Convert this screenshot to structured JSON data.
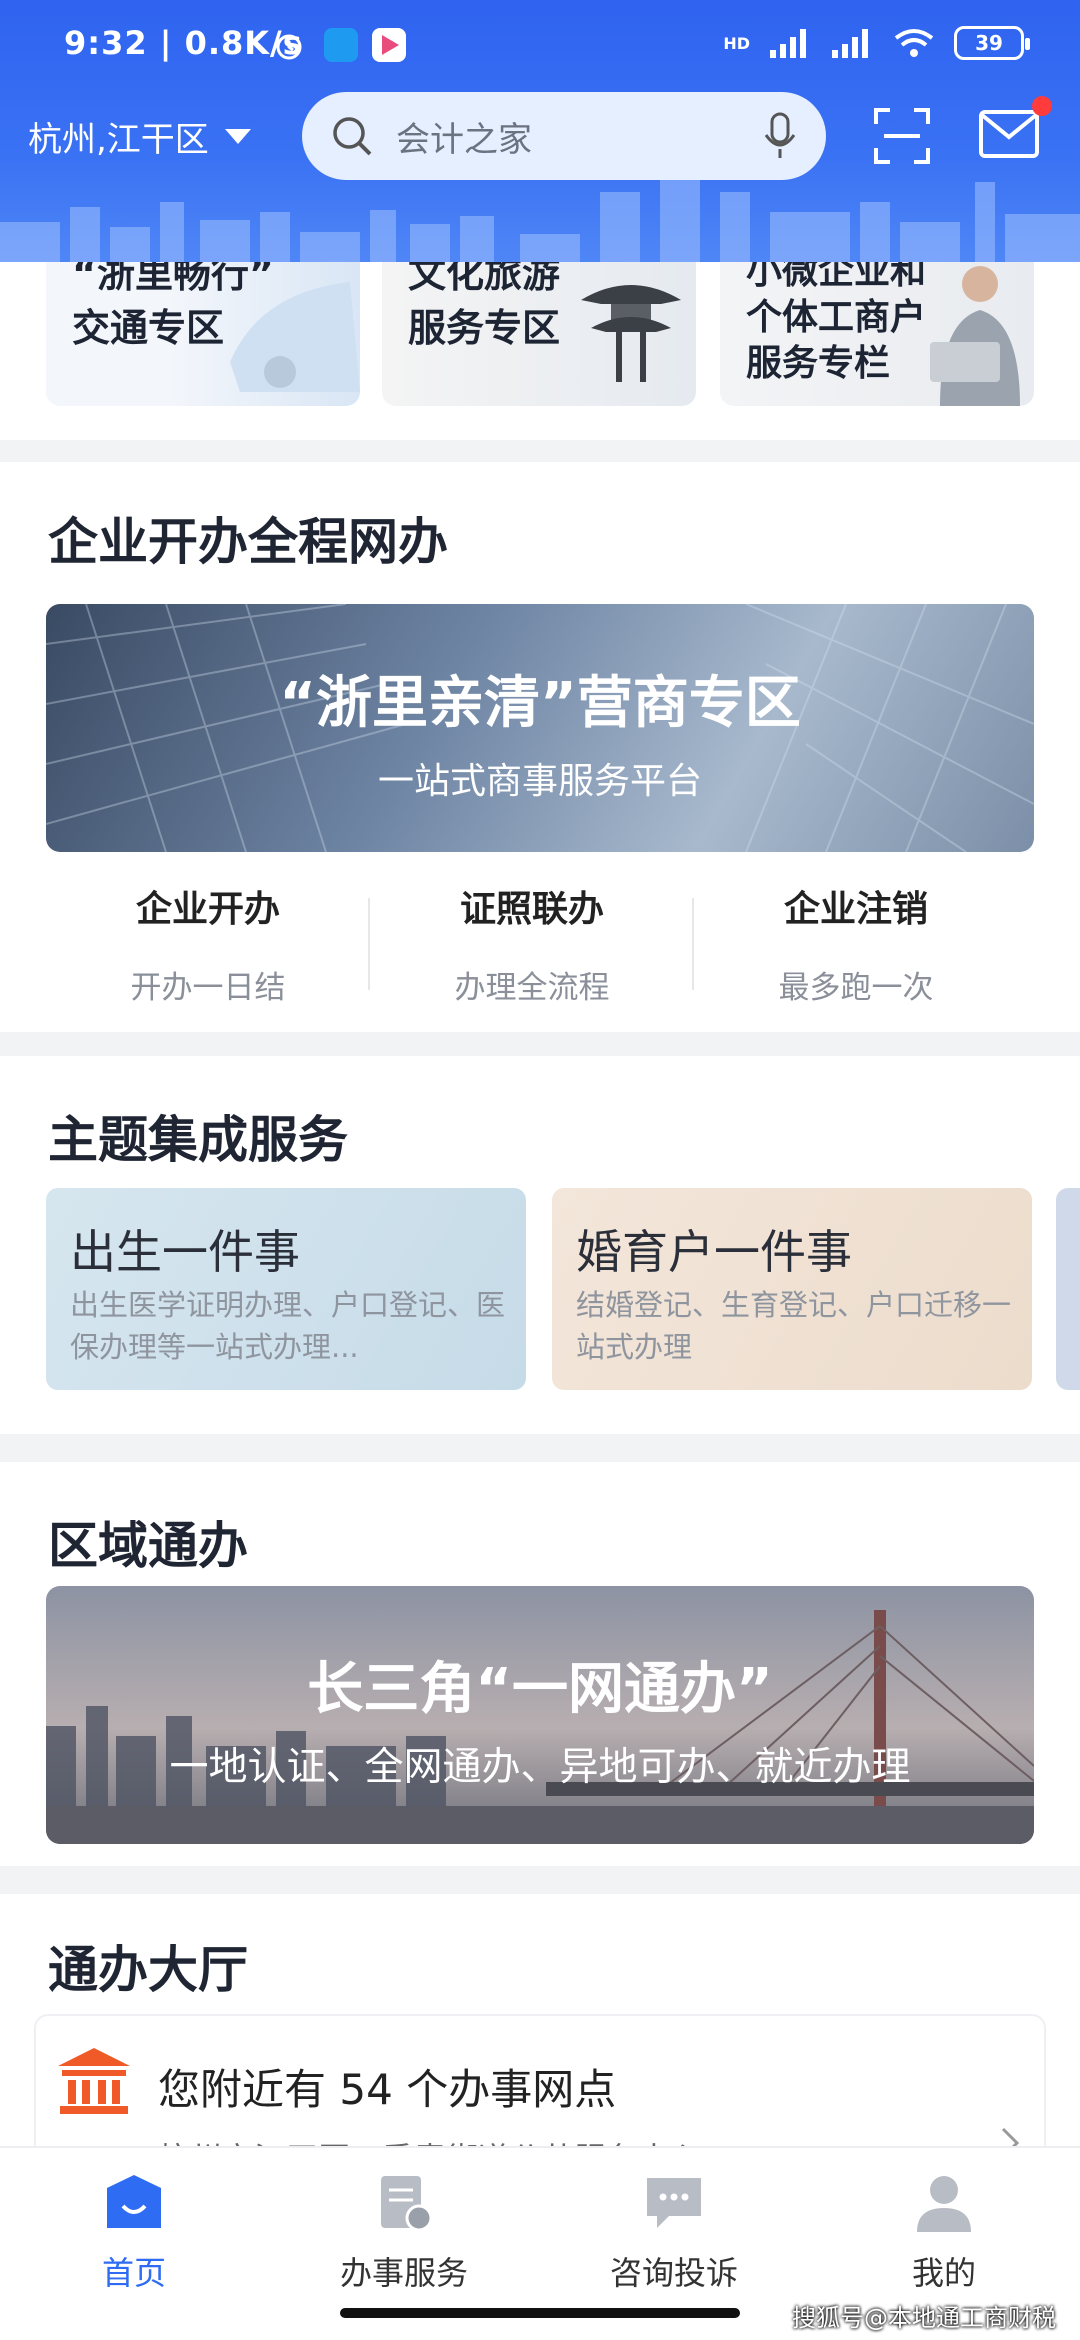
{
  "status_bar": {
    "time": "9:32",
    "net_speed": "0.8K/s",
    "signal_label": "HD",
    "battery": "39"
  },
  "header": {
    "location": "杭州,江干区",
    "search_placeholder": "会计之家",
    "colors": {
      "primary": "#2f63f0",
      "badge": "#ff3b3b"
    }
  },
  "top_cards": [
    {
      "label_line1": "“浙里畅行”",
      "label_line2": "交通专区"
    },
    {
      "label_line1": "文化旅游",
      "label_line2": "服务专区"
    },
    {
      "label_line1": "小微企业和",
      "label_line2": "个体工商户",
      "label_line3": "服务专栏"
    }
  ],
  "enterprise": {
    "title": "企业开办全程网办",
    "banner_title": "“浙里亲清”营商专区",
    "banner_sub": "一站式商事服务平台",
    "items": [
      {
        "title": "企业开办",
        "sub": "开办一日结"
      },
      {
        "title": "证照联办",
        "sub": "办理全流程"
      },
      {
        "title": "企业注销",
        "sub": "最多跑一次"
      }
    ]
  },
  "themes": {
    "title": "主题集成服务",
    "cards": [
      {
        "title": "出生一件事",
        "desc": "出生医学证明办理、户口登记、医保办理等一站式办理..."
      },
      {
        "title": "婚育户一件事",
        "desc": "结婚登记、生育登记、户口迁移一站式办理"
      }
    ]
  },
  "region": {
    "title": "区域通办",
    "banner_title": "长三角“一网通办”",
    "banner_sub": "一地认证、全网通办、异地可办、就近办理"
  },
  "hall": {
    "title": "通办大厅",
    "nearby_prefix": "您附近有",
    "nearby_count": "54",
    "nearby_suffix": "个办事网点",
    "sub": "杭州市江干区四季青街道公共服务中心"
  },
  "tabbar": [
    {
      "label": "首页",
      "active": true
    },
    {
      "label": "办事服务"
    },
    {
      "label": "咨询投诉"
    },
    {
      "label": "我的"
    }
  ],
  "watermark": "搜狐号@本地通工商财税"
}
